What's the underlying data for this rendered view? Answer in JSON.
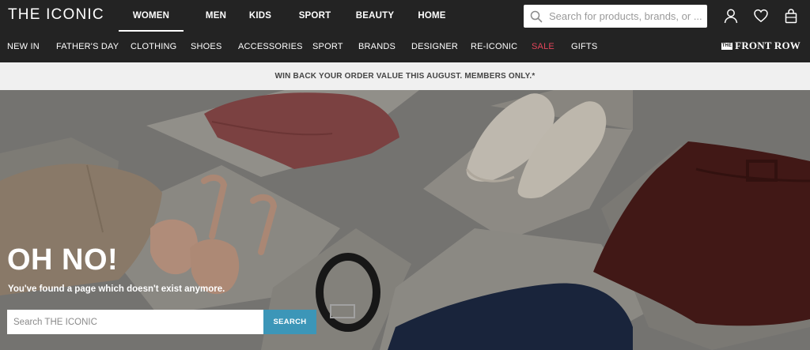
{
  "brand": {
    "logo": "THE ICONIC"
  },
  "main_nav": [
    {
      "label": "WOMEN",
      "active": true
    },
    {
      "label": "MEN",
      "active": false
    },
    {
      "label": "KIDS",
      "active": false
    },
    {
      "label": "SPORT",
      "active": false
    },
    {
      "label": "BEAUTY",
      "active": false
    },
    {
      "label": "HOME",
      "active": false
    }
  ],
  "search": {
    "placeholder": "Search for products, brands, or ..."
  },
  "header_icons": [
    "account-icon",
    "heart-icon",
    "bag-icon"
  ],
  "sub_nav": [
    {
      "label": "NEW IN"
    },
    {
      "label": "FATHER'S DAY"
    },
    {
      "label": "CLOTHING"
    },
    {
      "label": "SHOES"
    },
    {
      "label": "ACCESSORIES"
    },
    {
      "label": "SPORT"
    },
    {
      "label": "BRANDS"
    },
    {
      "label": "DESIGNER"
    },
    {
      "label": "RE-ICONIC"
    },
    {
      "label": "SALE",
      "sale": true
    },
    {
      "label": "GIFTS"
    }
  ],
  "front_row": {
    "label": "FRONT ROW",
    "mark": "THE"
  },
  "promo": {
    "text": "WIN BACK YOUR ORDER VALUE THIS AUGUST. MEMBERS ONLY.*"
  },
  "hero": {
    "heading": "OH NO!",
    "message": "You've found a page which doesn't exist anymore.",
    "search_placeholder": "Search THE ICONIC",
    "search_button": "SEARCH"
  },
  "colors": {
    "topbar": "#232323",
    "promo_bg": "#f0f0f0",
    "accent_button": "#3c96b8",
    "sale": "#e2455a"
  }
}
